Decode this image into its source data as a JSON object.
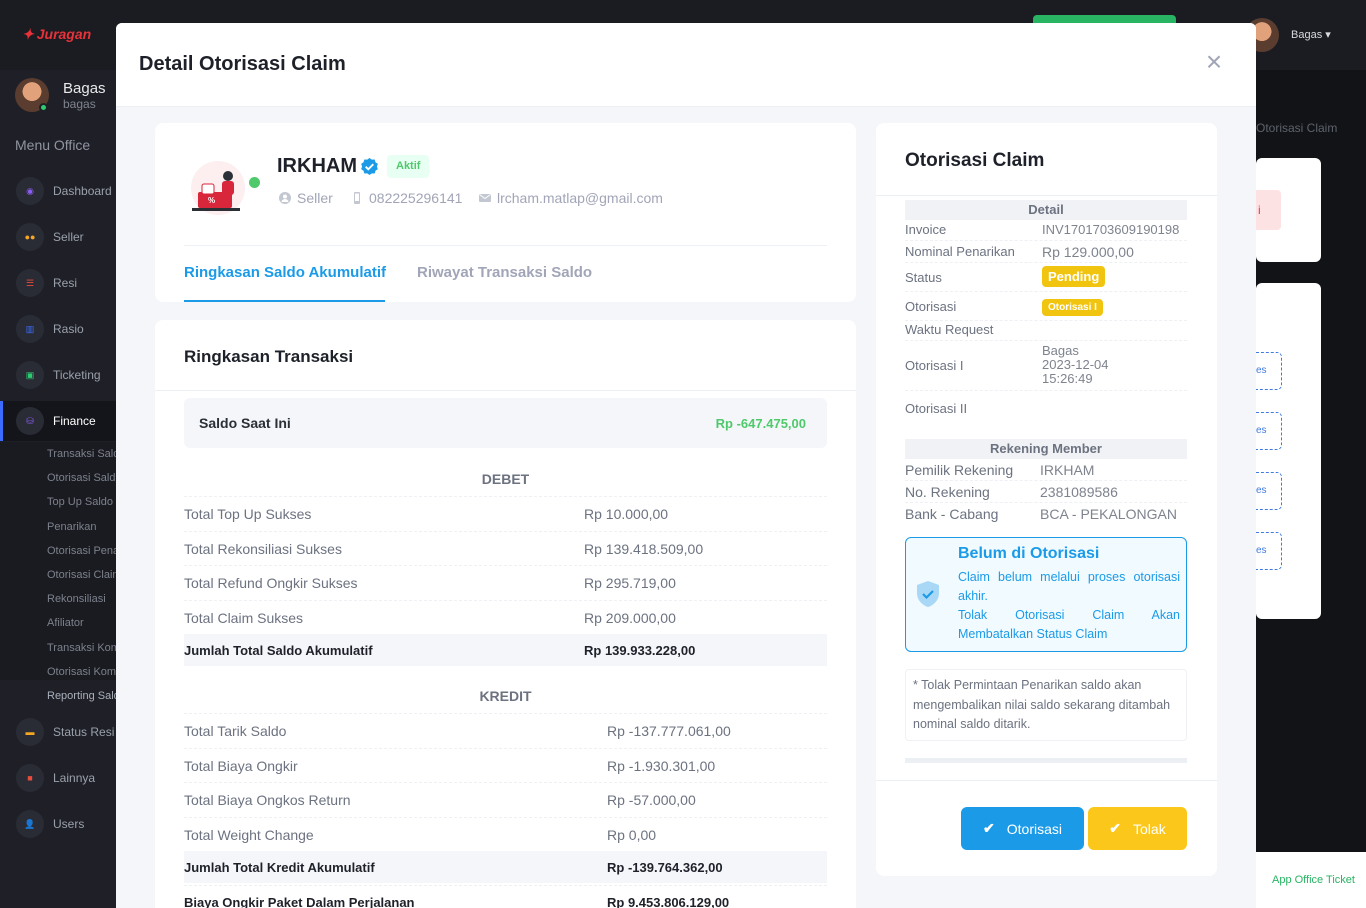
{
  "app": {
    "brand": "Juragan",
    "top_user": "Bagas",
    "sidebar_user_name": "Bagas",
    "sidebar_user_sub": "bagas",
    "menu_title": "Menu Office",
    "menu": [
      "Dashboard",
      "Seller",
      "Resi",
      "Rasio",
      "Ticketing",
      "Finance"
    ],
    "finance_submenu": [
      "Transaksi Saldo",
      "Otorisasi Saldo",
      "Top Up Saldo",
      "Penarikan",
      "Otorisasi Penarikan",
      "Otorisasi Claim",
      "Rekonsiliasi",
      "Afiliator",
      "Transaksi Komisi",
      "Otorisasi Komisi",
      "Reporting Saldo"
    ],
    "menu_bottom": [
      "Status Resi",
      "Lainnya",
      "Users"
    ],
    "bg_breadcrumb": "Otorisasi Claim",
    "bg_red_btn": "i",
    "bg_dash_label": "es",
    "ticket_label": "App Office Ticket"
  },
  "modal": {
    "title": "Detail Otorisasi Claim",
    "close": "×"
  },
  "profile": {
    "name": "IRKHAM",
    "status_badge": "Aktif",
    "role": "Seller",
    "phone": "082225296141",
    "email": "lrcham.matlap@gmail.com",
    "tabs": [
      "Ringkasan Saldo Akumulatif",
      "Riwayat Transaksi Saldo"
    ]
  },
  "summary": {
    "title": "Ringkasan Transaksi",
    "saldo_label": "Saldo Saat Ini",
    "saldo_value": "Rp -647.475,00",
    "debet_head": "DEBET",
    "debet_rows": [
      {
        "label": "Total Top Up Sukses",
        "value": "Rp 10.000,00"
      },
      {
        "label": "Total Rekonsiliasi Sukses",
        "value": "Rp 139.418.509,00"
      },
      {
        "label": "Total Refund Ongkir Sukses",
        "value": "Rp 295.719,00"
      },
      {
        "label": "Total Claim Sukses",
        "value": "Rp 209.000,00"
      }
    ],
    "debet_total": {
      "label": "Jumlah Total Saldo Akumulatif",
      "value": "Rp 139.933.228,00"
    },
    "kredit_head": "KREDIT",
    "kredit_rows": [
      {
        "label": "Total Tarik Saldo",
        "value": "Rp -137.777.061,00"
      },
      {
        "label": "Total Biaya Ongkir",
        "value": "Rp -1.930.301,00"
      },
      {
        "label": "Total Biaya Ongkos Return",
        "value": "Rp -57.000,00"
      },
      {
        "label": "Total Weight Change",
        "value": "Rp 0,00"
      }
    ],
    "kredit_total": {
      "label": "Jumlah Total Kredit Akumulatif",
      "value": "Rp -139.764.362,00"
    },
    "extra_row": {
      "label": "Biaya Ongkir Paket Dalam Perjalanan",
      "value": "Rp 9.453.806.129,00"
    }
  },
  "auth": {
    "title": "Otorisasi Claim",
    "detail_head": "Detail",
    "invoice_label": "Invoice",
    "invoice_value": "INV1701703609190198",
    "nominal_label": "Nominal Penarikan",
    "nominal_value": "Rp 129.000,00",
    "status_label": "Status",
    "status_value": "Pending",
    "otorisasi_label": "Otorisasi",
    "otorisasi_value": "Otorisasi I",
    "waktu_label": "Waktu Request",
    "oto1_label": "Otorisasi I",
    "oto1_name": "Bagas",
    "oto1_date": "2023-12-04",
    "oto1_time": "15:26:49",
    "oto2_label": "Otorisasi II",
    "rekening_head": "Rekening Member",
    "pemilik_label": "Pemilik Rekening",
    "pemilik_value": "IRKHAM",
    "norek_label": "No. Rekening",
    "norek_value": "2381089586",
    "bank_label": "Bank - Cabang",
    "bank_value": "BCA - PEKALONGAN",
    "info_title": "Belum di Otorisasi",
    "info_line1": "Claim belum melalui proses otorisasi akhir.",
    "info_line2": "Tolak Otorisasi Claim Akan Membatalkan Status Claim",
    "note": "* Tolak Permintaan Penarikan saldo akan mengembalikan nilai saldo sekarang ditambah nominal saldo ditarik.",
    "btn_approve": "Otorisasi",
    "btn_reject": "Tolak"
  },
  "colors": {
    "primary": "#1b9be7",
    "success": "#4fc96b",
    "warning": "#f1c40f",
    "reject_btn": "#fbc71a"
  }
}
